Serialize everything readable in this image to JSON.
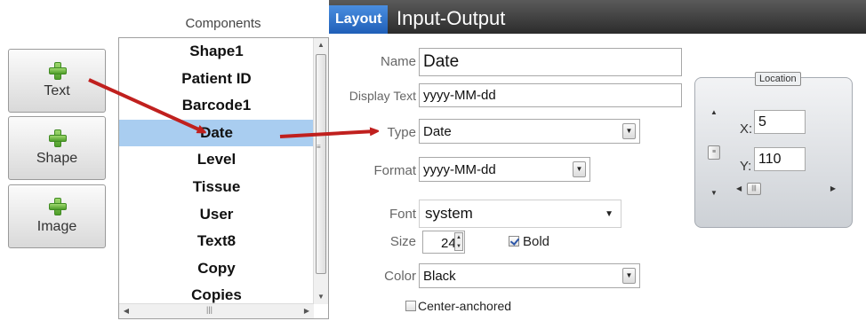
{
  "add_buttons": [
    {
      "label": "Text",
      "icon": "plus-icon"
    },
    {
      "label": "Shape",
      "icon": "plus-icon"
    },
    {
      "label": "Image",
      "icon": "plus-icon"
    }
  ],
  "components": {
    "title": "Components",
    "items": [
      "Shape1",
      "Patient ID",
      "Barcode1",
      "Date",
      "Level",
      "Tissue",
      "User",
      "Text8",
      "Copy",
      "Copies"
    ],
    "selected": "Date",
    "selection_color": "#a9cdf0"
  },
  "tabs": {
    "layout": "Layout",
    "input_output": "Input-Output",
    "active": "Layout",
    "active_color": "#2a6fc9"
  },
  "form": {
    "name_label": "Name",
    "name_value": "Date",
    "display_text_label": "Display Text",
    "display_text_value": "yyyy-MM-dd",
    "type_label": "Type",
    "type_value": "Date",
    "format_label": "Format",
    "format_value": "yyyy-MM-dd",
    "font_label": "Font",
    "font_value": "system",
    "size_label": "Size",
    "size_value": "24",
    "bold_label": "Bold",
    "bold_checked": true,
    "color_label": "Color",
    "color_value": "Black",
    "center_anchored_label": "Center-anchored",
    "center_anchored_checked": false
  },
  "location": {
    "title": "Location",
    "x_label": "X:",
    "x_value": "5",
    "y_label": "Y:",
    "y_value": "110"
  },
  "annotation_arrow_color": "#c0201e"
}
